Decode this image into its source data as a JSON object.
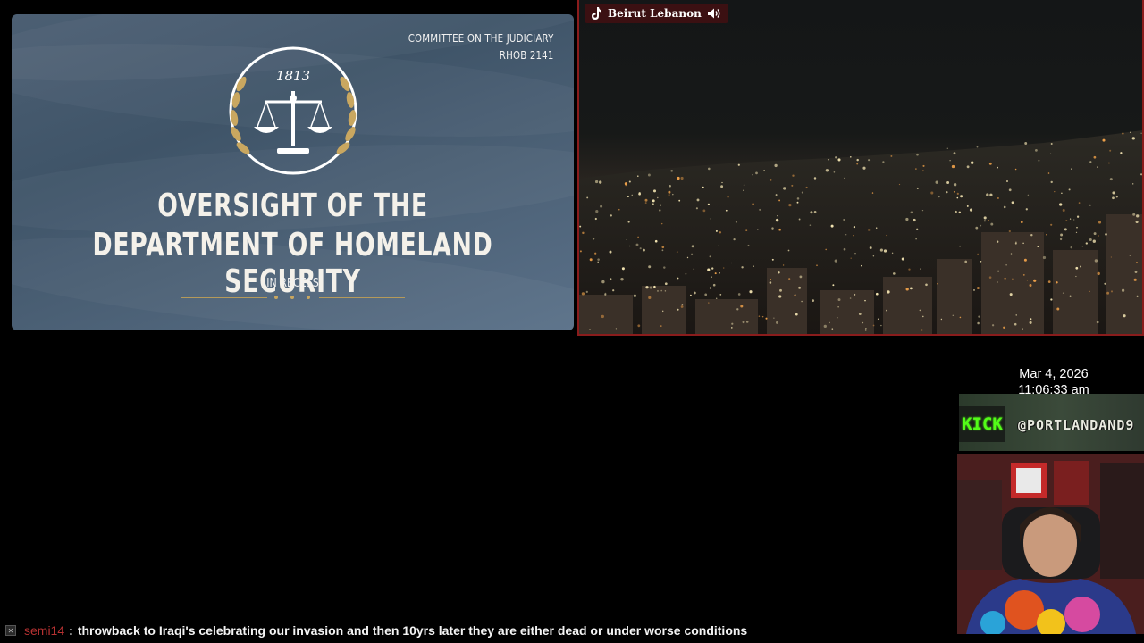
{
  "hearing_panel": {
    "committee_line1": "COMMITTEE ON THE JUDICIARY",
    "committee_line2": "RHOB 2141",
    "seal_year": "1813",
    "title_line1": "OVERSIGHT OF THE",
    "title_line2": "DEPARTMENT OF HOMELAND SECURITY",
    "status": "IN RECESS",
    "accent_color": "#c9a760",
    "background_color": "#45596d"
  },
  "citycam_panel": {
    "location_label": "Beirut Lebanon",
    "platform_icon": "tiktok-icon",
    "audio_icon": "speaker-icon",
    "border_color": "#8a1c1c"
  },
  "clock": {
    "date": "Mar 4, 2026",
    "time": "11:06:33 am"
  },
  "stream_banner": {
    "platform_text": "KICK",
    "handle": "@PORTLANDAND9",
    "platform_color": "#53fc18"
  },
  "chat": {
    "badge_icon": "moderator-badge-icon",
    "username": "semi14",
    "separator": ":",
    "message": "throwback to Iraqi's celebrating our invasion and then 10yrs later they are either dead or under worse conditions",
    "username_color": "#b83232"
  }
}
